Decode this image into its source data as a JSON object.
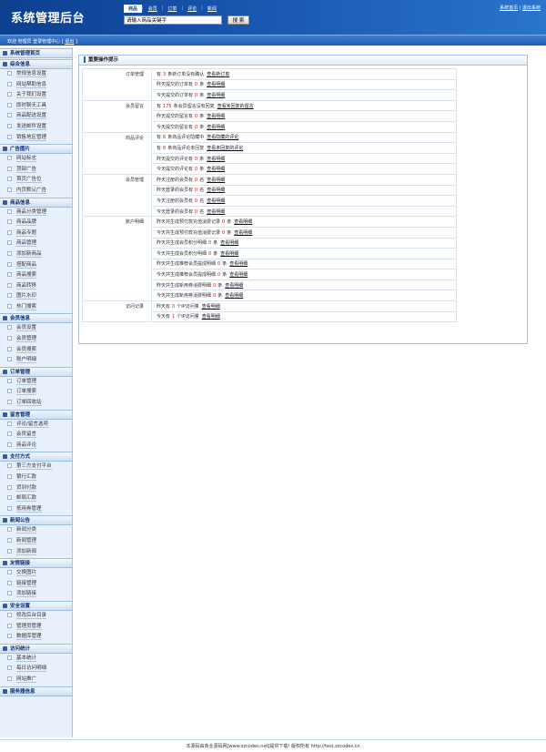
{
  "header": {
    "title": "系统管理后台",
    "tabs": [
      "商品",
      "会员",
      "订单",
      "评论",
      "新闻"
    ],
    "search_placeholder": "请输入商品关键字",
    "search_button": "搜 索",
    "links": [
      "系统首页",
      "退出系统"
    ]
  },
  "location": {
    "text": "欢迎 管理员 登录管理中心 [",
    "logout": "退出",
    "suffix": "]"
  },
  "sidebar": [
    {
      "title": "系统管理首页",
      "items": []
    },
    {
      "title": "综合信息",
      "items": [
        "常规信息设置",
        "网站帮助信息",
        "关于我们设置",
        "即时聊天工具",
        "商品配送设置",
        "发送邮件设置",
        "销售地区管理"
      ]
    },
    {
      "title": "广告图片",
      "items": [
        "网站标志",
        "顶部广告",
        "首页广告位",
        "内页默认广告"
      ]
    },
    {
      "title": "商品信息",
      "items": [
        "商品分类管理",
        "商品品牌",
        "商品专题",
        "商品管理",
        "添加新商品",
        "搭配商品",
        "商品搜索",
        "商品转移",
        "图片水印",
        "热门搜索"
      ]
    },
    {
      "title": "会员信息",
      "items": [
        "会员设置",
        "会员管理",
        "会员搜索",
        "账户明细"
      ]
    },
    {
      "title": "订单管理",
      "items": [
        "订单管理",
        "订单搜索",
        "订单回收站"
      ]
    },
    {
      "title": "留言管理",
      "items": [
        "评论/留言选项",
        "会员留言",
        "商品评论"
      ]
    },
    {
      "title": "支付方式",
      "items": [
        "第三方支付平台",
        "银行汇款",
        "货到付款",
        "邮局汇款",
        "抵用券管理"
      ]
    },
    {
      "title": "新闻公告",
      "items": [
        "新闻分类",
        "新闻管理",
        "添加新闻"
      ]
    },
    {
      "title": "友情链接",
      "items": [
        "交换图片",
        "链接管理",
        "添加链接"
      ]
    },
    {
      "title": "安全设置",
      "items": [
        "修改后台目录",
        "管理员管理",
        "数据库管理"
      ]
    },
    {
      "title": "访问统计",
      "items": [
        "基本统计",
        "每日访问明细",
        "网站推广"
      ]
    },
    {
      "title": "服务器信息",
      "items": []
    }
  ],
  "panel": {
    "title": "重要操作提示",
    "rows": [
      {
        "cat": "订单管理",
        "pre": "有",
        "num": "3",
        "post": "条新订单没有确认",
        "link": "查看新订单"
      },
      {
        "cat": "",
        "pre": "昨天提交的订单有",
        "num": "0",
        "post": "条",
        "link": "查看明细"
      },
      {
        "cat": "",
        "pre": "今天提交的订单有",
        "num": "0",
        "post": "条",
        "link": "查看明细"
      },
      {
        "cat": "会员留言",
        "pre": "有",
        "num": "175",
        "post": "条会员留言没有回复",
        "link": "查看未回复的留言"
      },
      {
        "cat": "",
        "pre": "昨天提交的留言有",
        "num": "0",
        "post": "条",
        "link": "查看明细"
      },
      {
        "cat": "",
        "pre": "今天提交的留言有",
        "num": "0",
        "post": "条",
        "link": "查看明细"
      },
      {
        "cat": "商品评论",
        "pre": "有",
        "num": "6",
        "post": "条商品评论隐藏中",
        "link": "查看隐藏的评论"
      },
      {
        "cat": "",
        "pre": "有",
        "num": "8",
        "post": "条商品评论未回复",
        "link": "查看未回复的评论"
      },
      {
        "cat": "",
        "pre": "昨天提交的评论有",
        "num": "0",
        "post": "条",
        "link": "查看明细"
      },
      {
        "cat": "",
        "pre": "今天提交的评论有",
        "num": "0",
        "post": "条",
        "link": "查看明细"
      },
      {
        "cat": "会员管理",
        "pre": "昨天注册的会员有",
        "num": "0",
        "post": "名",
        "link": "查看明细"
      },
      {
        "cat": "",
        "pre": "昨天登录的会员有",
        "num": "0",
        "post": "名",
        "link": "查看明细"
      },
      {
        "cat": "",
        "pre": "今天注册的会员有",
        "num": "0",
        "post": "名",
        "link": "查看明细"
      },
      {
        "cat": "",
        "pre": "今天登录的会员有",
        "num": "0",
        "post": "名",
        "link": "查看明细"
      },
      {
        "cat": "账户明细",
        "pre": "昨天共生成预付款充值消费记录",
        "num": "0",
        "post": "条",
        "link": "查看明细"
      },
      {
        "cat": "",
        "pre": "今天共生成预付款充值消费记录",
        "num": "0",
        "post": "条",
        "link": "查看明细"
      },
      {
        "cat": "",
        "pre": "昨天共生成会员积分明细",
        "num": "0",
        "post": "条",
        "link": "查看明细"
      },
      {
        "cat": "",
        "pre": "今天共生成会员积分明细",
        "num": "0",
        "post": "条",
        "link": "查看明细"
      },
      {
        "cat": "",
        "pre": "昨天共生成推荐会员提成明细",
        "num": "0",
        "post": "条",
        "link": "查看明细"
      },
      {
        "cat": "",
        "pre": "今天共生成推荐会员提成明细",
        "num": "0",
        "post": "条",
        "link": "查看明细"
      },
      {
        "cat": "",
        "pre": "昨天共生成新用券消费明细",
        "num": "0",
        "post": "条",
        "link": "查看明细"
      },
      {
        "cat": "",
        "pre": "今天共生成新用券消费明细",
        "num": "0",
        "post": "条",
        "link": "查看明细"
      },
      {
        "cat": "访问记录",
        "pre": "昨天有",
        "num": "0",
        "post": "个IP访问量",
        "link": "查看明细"
      },
      {
        "cat": "",
        "pre": "今天有",
        "num": "1",
        "post": "个IP访问量",
        "link": "查看明细"
      }
    ]
  },
  "footer": "本源码由商业源码网[www.zzcodes.net]提供下载! 版权所有 http://test.zzcodes.cn"
}
